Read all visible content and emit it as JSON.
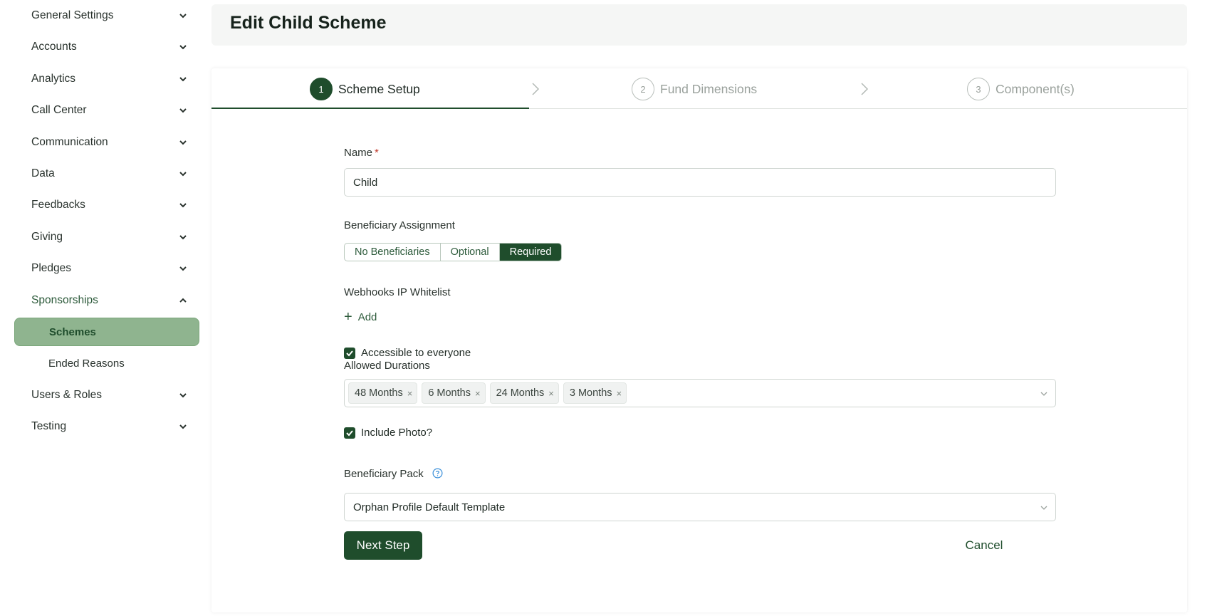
{
  "sidebar": {
    "items": [
      {
        "label": "General Settings",
        "icon": "chevron-down-icon"
      },
      {
        "label": "Accounts",
        "icon": "chevron-down-icon"
      },
      {
        "label": "Analytics",
        "icon": "chevron-down-icon"
      },
      {
        "label": "Call Center",
        "icon": "chevron-down-icon"
      },
      {
        "label": "Communication",
        "icon": "chevron-down-icon"
      },
      {
        "label": "Data",
        "icon": "chevron-down-icon"
      },
      {
        "label": "Feedbacks",
        "icon": "chevron-down-icon"
      },
      {
        "label": "Giving",
        "icon": "chevron-down-icon"
      },
      {
        "label": "Pledges",
        "icon": "chevron-down-icon"
      },
      {
        "label": "Sponsorships",
        "icon": "chevron-up-icon",
        "expanded": true
      },
      {
        "label": "Users & Roles",
        "icon": "chevron-down-icon"
      },
      {
        "label": "Testing",
        "icon": "chevron-down-icon"
      }
    ],
    "sub_items": [
      {
        "label": "Schemes",
        "active": true
      },
      {
        "label": "Ended Reasons",
        "active": false
      }
    ]
  },
  "header": {
    "title": "Edit Child Scheme"
  },
  "steps": [
    {
      "number": "1",
      "label": "Scheme Setup",
      "active": true
    },
    {
      "number": "2",
      "label": "Fund Dimensions",
      "active": false
    },
    {
      "number": "3",
      "label": "Component(s)",
      "active": false
    }
  ],
  "form": {
    "name_label": "Name",
    "name_required_mark": "*",
    "name_value": "Child",
    "assignment_label": "Beneficiary Assignment",
    "assignment_options": [
      "No Beneficiaries",
      "Optional",
      "Required"
    ],
    "assignment_selected": "Required",
    "webhooks_label": "Webhooks IP Whitelist",
    "add_label": "Add",
    "accessible_label": "Accessible to everyone",
    "accessible_checked": true,
    "durations_label": "Allowed Durations",
    "durations": [
      "48 Months",
      "6 Months",
      "24 Months",
      "3 Months"
    ],
    "tag_remove_glyph": "×",
    "include_photo_label": "Include Photo?",
    "include_photo_checked": true,
    "pack_label": "Beneficiary Pack",
    "pack_value": "Orphan Profile Default Template"
  },
  "actions": {
    "next_label": "Next Step",
    "cancel_label": "Cancel"
  },
  "colors": {
    "primary": "#1f4d2c",
    "active_nav_bg": "#8fb48f",
    "help_icon": "#3a8fd9"
  }
}
